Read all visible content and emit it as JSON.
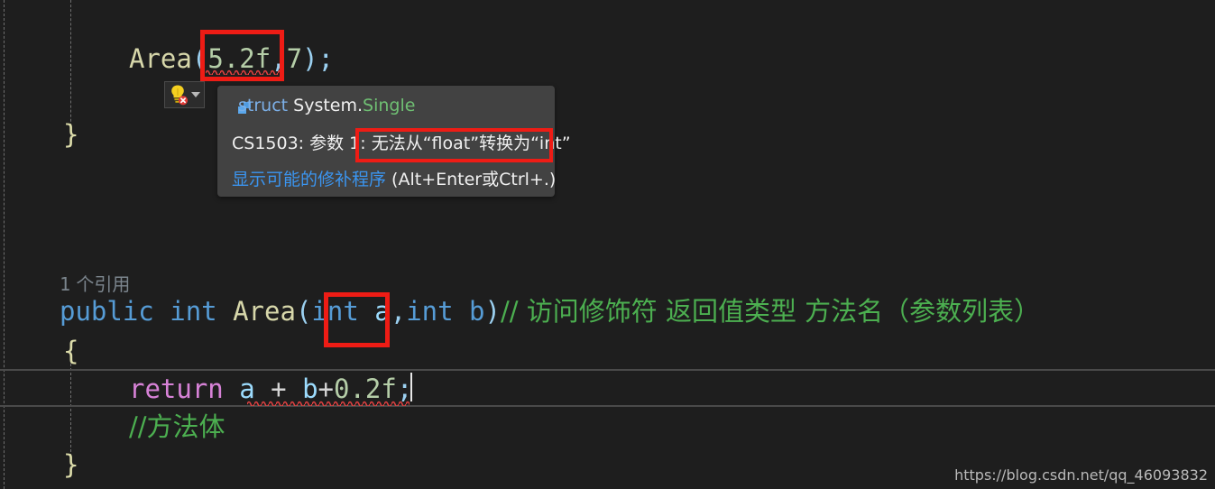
{
  "app": {
    "name": "visual-studio-code-editor",
    "theme": "dark",
    "background_color": "#1e1e1e"
  },
  "code_lines": [
    {
      "id": "call_line",
      "tokens": [
        {
          "text": "Area",
          "kind": "method"
        },
        {
          "text": "(",
          "kind": "punct"
        },
        {
          "text": "5.2f",
          "kind": "number"
        },
        {
          "text": ",",
          "kind": "punct"
        },
        {
          "text": "7",
          "kind": "number"
        },
        {
          "text": ")",
          "kind": "punct"
        },
        {
          "text": ";",
          "kind": "punct"
        }
      ]
    },
    {
      "id": "close_brace_outer",
      "tokens": [
        {
          "text": "}",
          "kind": "brace"
        }
      ]
    },
    {
      "id": "signature_line",
      "tokens": [
        {
          "text": "public",
          "kind": "keyword"
        },
        {
          "text": " ",
          "kind": "plain"
        },
        {
          "text": "int",
          "kind": "keyword"
        },
        {
          "text": " ",
          "kind": "plain"
        },
        {
          "text": "Area",
          "kind": "method"
        },
        {
          "text": "(",
          "kind": "punct"
        },
        {
          "text": "int",
          "kind": "keyword"
        },
        {
          "text": " ",
          "kind": "plain"
        },
        {
          "text": "a",
          "kind": "variable"
        },
        {
          "text": ",",
          "kind": "punct"
        },
        {
          "text": "int",
          "kind": "keyword"
        },
        {
          "text": " ",
          "kind": "plain"
        },
        {
          "text": "b",
          "kind": "variable"
        },
        {
          "text": ")",
          "kind": "punct"
        }
      ]
    },
    {
      "id": "open_brace_method",
      "tokens": [
        {
          "text": "{",
          "kind": "brace"
        }
      ]
    },
    {
      "id": "return_line",
      "tokens": [
        {
          "text": "return",
          "kind": "control"
        },
        {
          "text": " ",
          "kind": "plain"
        },
        {
          "text": "a",
          "kind": "variable"
        },
        {
          "text": " + ",
          "kind": "operator"
        },
        {
          "text": "b",
          "kind": "variable"
        },
        {
          "text": "+",
          "kind": "operator"
        },
        {
          "text": "0.2f",
          "kind": "number"
        },
        {
          "text": ";",
          "kind": "punct"
        }
      ]
    },
    {
      "id": "close_brace_method",
      "tokens": [
        {
          "text": "}",
          "kind": "brace"
        }
      ]
    }
  ],
  "editor": {
    "call_text": "Area",
    "call_open_paren": "(",
    "call_arg1": "5.2f",
    "call_comma": ",",
    "call_arg2": "7",
    "call_close": ");",
    "brace_close_outer": "}",
    "sig_public": "public",
    "sig_int": "int",
    "sig_name": "Area",
    "sig_open": "(",
    "sig_param1_type": "int",
    "sig_param1_name": " a",
    "sig_comma": ",",
    "sig_param2": "int b",
    "sig_close": ")",
    "sig_comment": "// 访问修饰符 返回值类型 方法名（参数列表）",
    "brace_open_method": "{",
    "return_kw": "return",
    "return_expr_a": " a ",
    "return_op": "+",
    "return_expr_b": " b",
    "return_op2": "+",
    "return_num": "0.2f",
    "return_semi": ";",
    "body_comment": "//方法体",
    "brace_close_method": "}"
  },
  "codelens": {
    "count": "1",
    "label": " 个引用"
  },
  "quick_action": {
    "icon": "lightbulb-error-icon",
    "dropdown_icon": "chevron-down-icon",
    "tooltip": "显示可能的修补程序"
  },
  "tooltip": {
    "icon": "struct-icon",
    "type_keyword": "struct ",
    "type_namespace": "System.",
    "type_name": "Single",
    "error_prefix": "CS1503: 参数 1: ",
    "error_message": "无法从“float”转换为“int”",
    "fix_link": "显示可能的修补程序",
    "fix_shortcut": " (Alt+Enter或Ctrl+.)",
    "background_color": "#424242"
  },
  "annotations": {
    "box_color": "#ee1c15",
    "boxes": [
      {
        "name": "highlight-box-float-literal",
        "target": "5.2f"
      },
      {
        "name": "highlight-box-error-message",
        "target": "无法从“float”转换为“int”"
      },
      {
        "name": "highlight-box-int-param-type",
        "target": "int"
      }
    ]
  },
  "watermark": {
    "text": "https://blog.csdn.net/qq_46093832"
  }
}
